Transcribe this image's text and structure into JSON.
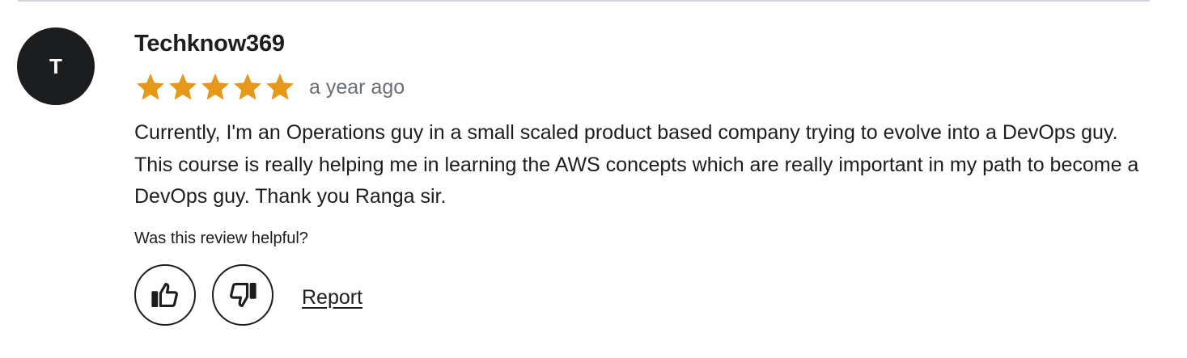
{
  "review": {
    "avatar_initial": "T",
    "reviewer_name": "Techknow369",
    "rating": 5,
    "rating_max": 5,
    "date": "a year ago",
    "body": "Currently, I'm an Operations guy in a small scaled product based company trying to evolve into a DevOps guy. This course is really helping me in learning the AWS concepts which are really important in my path to become a DevOps guy. Thank you Ranga sir.",
    "helpful_prompt": "Was this review helpful?",
    "report_label": "Report"
  },
  "icons": {
    "star": "star-icon",
    "thumbs_up": "thumbs-up-icon",
    "thumbs_down": "thumbs-down-icon"
  },
  "colors": {
    "star": "#e59819",
    "text": "#1c1d1f",
    "muted": "#6a6f73",
    "avatar_bg": "#1c1d1f",
    "divider": "#d1d7dc"
  }
}
